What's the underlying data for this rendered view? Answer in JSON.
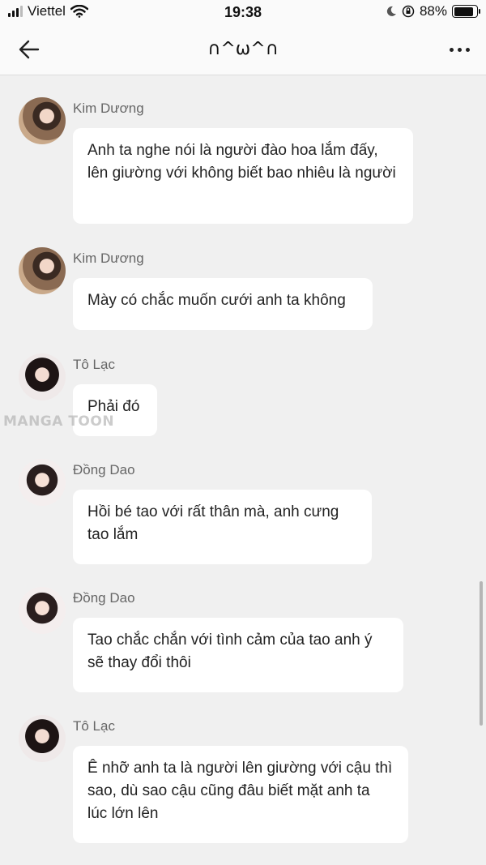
{
  "status_bar": {
    "carrier": "Viettel",
    "time": "19:38",
    "battery": "88%",
    "battery_level": 0.88
  },
  "nav": {
    "title": "∩^ω^∩"
  },
  "messages": [
    {
      "sender": "Kim Dương",
      "text": "Anh ta nghe nói là người đào hoa lắm đấy, lên giường với không biết bao nhiêu là người"
    },
    {
      "sender": "Kim Dương",
      "text": "Mày có chắc muốn cưới anh ta không"
    },
    {
      "sender": "Tô Lạc",
      "text": "Phải đó"
    },
    {
      "sender": "Đồng Dao",
      "text": "Hồi bé tao với rất thân mà, anh cưng tao lắm"
    },
    {
      "sender": "Đồng Dao",
      "text": "Tao chắc chắn với tình cảm của tao anh ý sẽ thay đổi thôi"
    },
    {
      "sender": "Tô Lạc",
      "text": "Ê nhỡ anh ta là người lên giường với cậu thì sao, dù sao cậu cũng đâu biết mặt anh ta lúc lớn lên"
    }
  ],
  "watermark": "MANGA TOON"
}
